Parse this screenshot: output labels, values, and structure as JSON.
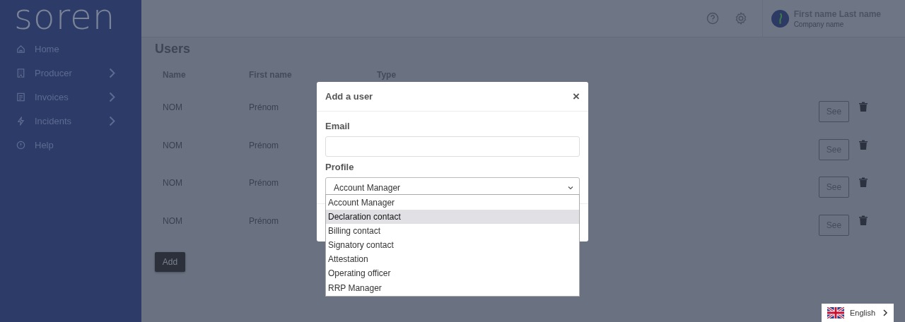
{
  "sidebar": {
    "logo": "soren",
    "items": [
      {
        "label": "Home",
        "expandable": false
      },
      {
        "label": "Producer",
        "expandable": true
      },
      {
        "label": "Invoices",
        "expandable": true
      },
      {
        "label": "Incidents",
        "expandable": true
      },
      {
        "label": "Help",
        "expandable": false
      }
    ]
  },
  "header": {
    "user_name": "First name Last name",
    "company": "Company name"
  },
  "page": {
    "title": "Users",
    "columns": [
      "Name",
      "First name",
      "Type"
    ],
    "rows": [
      {
        "name": "NOM",
        "first_name": "Prénom",
        "action": "See"
      },
      {
        "name": "NOM",
        "first_name": "Prénom",
        "action": "See"
      },
      {
        "name": "NOM",
        "first_name": "Prénom",
        "action": "See"
      },
      {
        "name": "NOM",
        "first_name": "Prénom",
        "action": "See"
      }
    ],
    "add_button": "Add"
  },
  "modal": {
    "title": "Add a user",
    "close": "×",
    "email_label": "Email",
    "profile_label": "Profile",
    "profile_value": "Account Manager",
    "options": [
      {
        "label": "Account Manager",
        "selected": false
      },
      {
        "label": "Declaration contact",
        "selected": true
      },
      {
        "label": "Billing contact",
        "selected": false
      },
      {
        "label": "Signatory contact",
        "selected": false
      },
      {
        "label": "Attestation",
        "selected": false
      },
      {
        "label": "Operating officer",
        "selected": false
      },
      {
        "label": "RRP Manager",
        "selected": false
      }
    ]
  },
  "language": {
    "label": "English"
  }
}
